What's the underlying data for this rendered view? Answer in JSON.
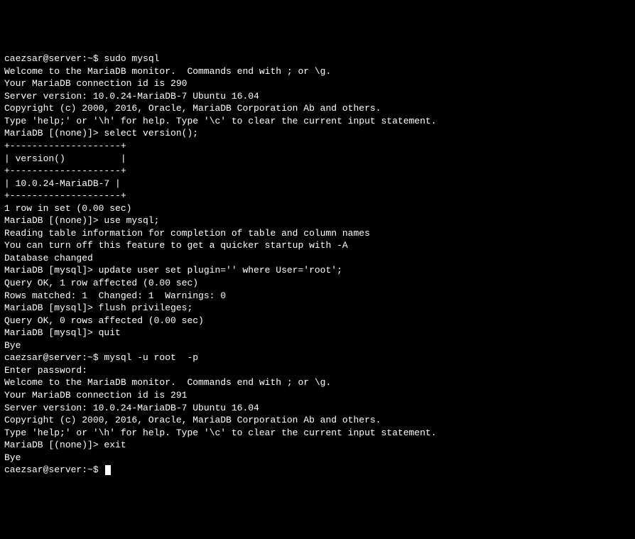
{
  "terminal": {
    "lines": [
      "caezsar@server:~$ sudo mysql",
      "Welcome to the MariaDB monitor.  Commands end with ; or \\g.",
      "Your MariaDB connection id is 290",
      "Server version: 10.0.24-MariaDB-7 Ubuntu 16.04",
      "",
      "Copyright (c) 2000, 2016, Oracle, MariaDB Corporation Ab and others.",
      "",
      "Type 'help;' or '\\h' for help. Type '\\c' to clear the current input statement.",
      "",
      "MariaDB [(none)]> select version();",
      "+--------------------+",
      "| version()          |",
      "+--------------------+",
      "| 10.0.24-MariaDB-7 |",
      "+--------------------+",
      "1 row in set (0.00 sec)",
      "",
      "MariaDB [(none)]> use mysql;",
      "Reading table information for completion of table and column names",
      "You can turn off this feature to get a quicker startup with -A",
      "",
      "Database changed",
      "MariaDB [mysql]> update user set plugin='' where User='root';",
      "Query OK, 1 row affected (0.00 sec)",
      "Rows matched: 1  Changed: 1  Warnings: 0",
      "",
      "MariaDB [mysql]> flush privileges;",
      "Query OK, 0 rows affected (0.00 sec)",
      "",
      "MariaDB [mysql]> quit",
      "Bye",
      "caezsar@server:~$ mysql -u root  -p",
      "Enter password:",
      "Welcome to the MariaDB monitor.  Commands end with ; or \\g.",
      "Your MariaDB connection id is 291",
      "Server version: 10.0.24-MariaDB-7 Ubuntu 16.04",
      "",
      "Copyright (c) 2000, 2016, Oracle, MariaDB Corporation Ab and others.",
      "",
      "Type 'help;' or '\\h' for help. Type '\\c' to clear the current input statement.",
      "",
      "MariaDB [(none)]> exit",
      "Bye",
      "caezsar@server:~$ "
    ]
  }
}
